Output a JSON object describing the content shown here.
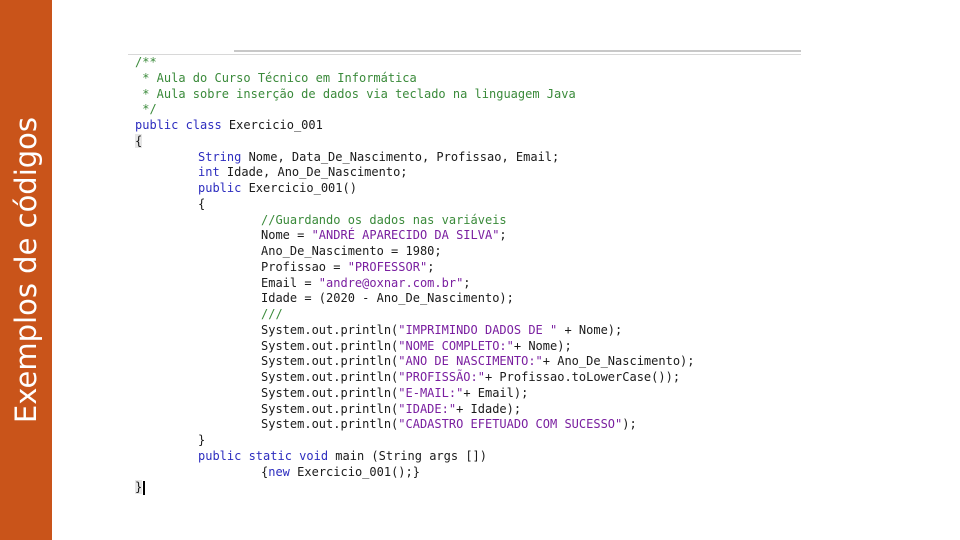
{
  "slide": {
    "title": "Exemplos de códigos",
    "accent_color": "#c9541a"
  },
  "code": {
    "c1": "/**",
    "c2": " * Aula do Curso Técnico em Informática",
    "c3": " * Aula sobre inserção de dados via teclado na linguagem Java",
    "c4": " */",
    "l5_kw": "public class",
    "l5_rest": " Exercicio_001",
    "l6": "{",
    "l7_kw": "String",
    "l7_rest": " Nome, Data_De_Nascimento, Profissao, Email;",
    "l8_kw": "int",
    "l8_rest": " Idade, Ano_De_Nascimento;",
    "l9_kw": "public",
    "l9_rest": " Exercicio_001()",
    "l10": "{",
    "l11_cm": "//Guardando os dados nas variáveis",
    "l12_a": "Nome = ",
    "l12_s": "\"ANDRÉ APARECIDO DA SILVA\"",
    "l12_b": ";",
    "l13": "Ano_De_Nascimento = 1980;",
    "l14_a": "Profissao = ",
    "l14_s": "\"PROFESSOR\"",
    "l14_b": ";",
    "l15_a": "Email = ",
    "l15_s": "\"andre@oxnar.com.br\"",
    "l15_b": ";",
    "l16": "Idade = (2020 - Ano_De_Nascimento);",
    "l17_cm": "///",
    "l18_a": "System.out.println(",
    "l18_s": "\"IMPRIMINDO DADOS DE \"",
    "l18_b": " + Nome);",
    "l19_a": "System.out.println(",
    "l19_s": "\"NOME COMPLETO:\"",
    "l19_b": "+ Nome);",
    "l20_a": "System.out.println(",
    "l20_s": "\"ANO DE NASCIMENTO:\"",
    "l20_b": "+ Ano_De_Nascimento);",
    "l21_a": "System.out.println(",
    "l21_s": "\"PROFISSÃO:\"",
    "l21_b": "+ Profissao.toLowerCase());",
    "l22_a": "System.out.println(",
    "l22_s": "\"E-MAIL:\"",
    "l22_b": "+ Email);",
    "l23_a": "System.out.println(",
    "l23_s": "\"IDADE:\"",
    "l23_b": "+ Idade);",
    "l24_a": "System.out.println(",
    "l24_s": "\"CADASTRO EFETUADO COM SUCESSO\"",
    "l24_b": ");",
    "l25": "}",
    "l26_kw": "public static void",
    "l26_rest": " main (String args [])",
    "l27_a": "{",
    "l27_kw": "new",
    "l27_b": " Exercicio_001();}",
    "l28": "}"
  }
}
